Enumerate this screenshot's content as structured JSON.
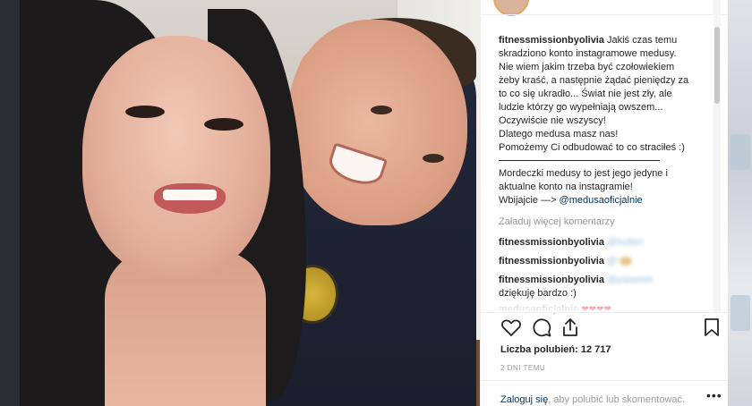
{
  "post": {
    "caption_user": "fitnessmissionbyolivia",
    "caption_lines": [
      "Jakiś czas temu",
      "skradziono konto instagramowe medusy.",
      "Nie wiem jakim trzeba być czołowiekiem",
      "żeby kraść, a następnie żądać pieniędzy za",
      "to co się ukradło... Świat nie jest zły, ale",
      "ludzie którzy go wypełniają owszem...",
      "Oczywiście nie wszyscy!",
      "Dlatego medusa masz nas!",
      "Pomożemy Ci odbudować to co straciłeś :)"
    ],
    "caption_after": [
      "Mordeczki medusy to jest jego jedyne i",
      "aktualne konto na instagramie!"
    ],
    "caption_mention_prefix": "Wbijajcie —> ",
    "caption_mention": "@medusaoficjalnie"
  },
  "comments": {
    "load_more": "Załaduj więcej komentarzy",
    "items": [
      {
        "user": "fitnessmissionbyolivia",
        "text": "@bullen"
      },
      {
        "user": "fitnessmissionbyolivia",
        "text": "@"
      },
      {
        "user": "fitnessmissionbyolivia",
        "text": "@pawelek",
        "reply": "dziękuję bardzo :)"
      },
      {
        "user": "medusaoficjalnie",
        "text": "❤❤❤❤"
      }
    ]
  },
  "actions": {
    "like_icon": "heart-outline-icon",
    "comment_icon": "speech-bubble-icon",
    "share_icon": "share-icon",
    "save_icon": "bookmark-icon"
  },
  "likes": {
    "label": "Liczba polubień: 12 717"
  },
  "date": "2 DNI TEMU",
  "login_prompt": {
    "link": "Zaloguj się",
    "text": ", aby polubić lub skomentować."
  },
  "more_icon": "more-options-icon",
  "colors": {
    "link": "#003569",
    "muted": "#999999",
    "text": "#262626",
    "heart": "#ed4956"
  }
}
